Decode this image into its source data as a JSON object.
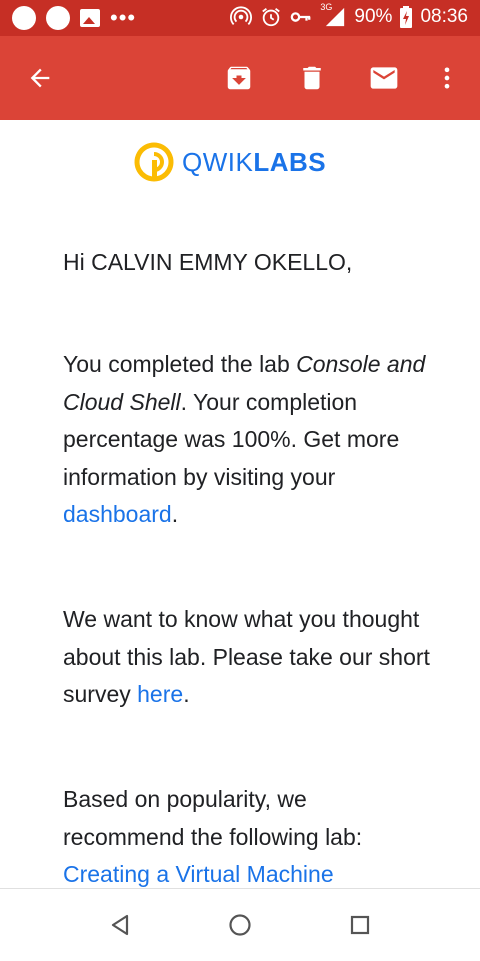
{
  "status_bar": {
    "signal": "3G",
    "battery": "90%",
    "time": "08:36",
    "icons": [
      "notification-dot-icon",
      "notification-dot-icon",
      "image-icon",
      "more-icon",
      "hotspot-icon",
      "alarm-icon",
      "key-icon",
      "signal-icon",
      "battery-icon"
    ]
  },
  "toolbar": {
    "icons": [
      "back-arrow-icon",
      "archive-icon",
      "delete-icon",
      "mail-icon",
      "overflow-menu-icon"
    ]
  },
  "brand": {
    "logo_text_light": "QWIK",
    "logo_text_bold": "LABS"
  },
  "email": {
    "greeting": "Hi CALVIN EMMY OKELLO,",
    "p1_pre": "You completed the lab ",
    "p1_lab": "Console and Cloud Shell",
    "p1_mid": ". Your completion percentage was 100%. Get more information by visiting your ",
    "p1_link": "dashboard",
    "p1_end": ".",
    "p2_pre": "We want to know what you thought about this lab. Please take our short survey ",
    "p2_link": "here",
    "p2_end": ".",
    "p3_text": "Based on popularity, we recommend the following lab: ",
    "p3_link": "Creating a Virtual Machine"
  },
  "colors": {
    "status_bar": "#c62f25",
    "toolbar": "#db4437",
    "link": "#1a73e8",
    "logo_yellow": "#fbbc04"
  },
  "nav_bar": {
    "icons": [
      "back-triangle-icon",
      "home-circle-icon",
      "recents-square-icon"
    ]
  }
}
